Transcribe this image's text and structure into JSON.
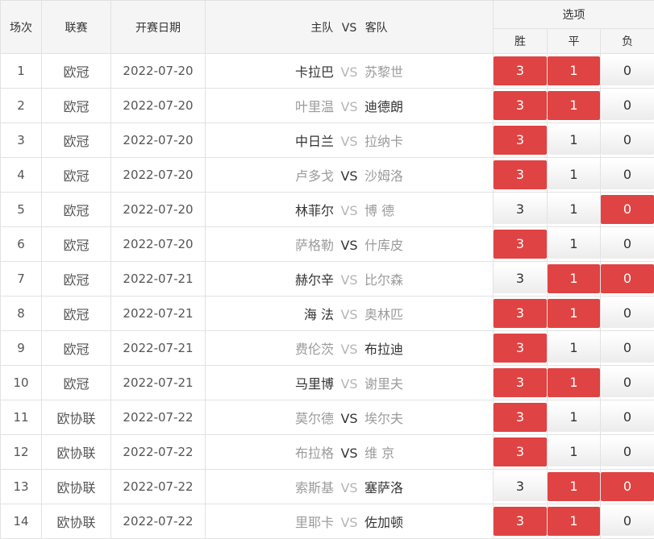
{
  "headers": {
    "index": "场次",
    "league": "联赛",
    "date": "开赛日期",
    "home": "主队",
    "vs": "VS",
    "away": "客队",
    "options": "选项",
    "win": "胜",
    "draw": "平",
    "loss": "负"
  },
  "colors": {
    "selected": "#e04343",
    "muted_text": "#9b9b9b",
    "header_bg": "#f5f5f5"
  },
  "rows": [
    {
      "index": "1",
      "league": "欧冠",
      "date": "2022-07-20",
      "home": "卡拉巴",
      "away": "苏黎世",
      "emph": "home",
      "win": "3",
      "draw": "1",
      "loss": "0",
      "sel": [
        true,
        true,
        false
      ]
    },
    {
      "index": "2",
      "league": "欧冠",
      "date": "2022-07-20",
      "home": "叶里温",
      "away": "迪德朗",
      "emph": "away",
      "win": "3",
      "draw": "1",
      "loss": "0",
      "sel": [
        true,
        true,
        false
      ]
    },
    {
      "index": "3",
      "league": "欧冠",
      "date": "2022-07-20",
      "home": "中日兰",
      "away": "拉纳卡",
      "emph": "home",
      "win": "3",
      "draw": "1",
      "loss": "0",
      "sel": [
        true,
        false,
        false
      ]
    },
    {
      "index": "4",
      "league": "欧冠",
      "date": "2022-07-20",
      "home": "卢多戈",
      "away": "沙姆洛",
      "emph": "none",
      "win": "3",
      "draw": "1",
      "loss": "0",
      "sel": [
        true,
        false,
        false
      ]
    },
    {
      "index": "5",
      "league": "欧冠",
      "date": "2022-07-20",
      "home": "林菲尔",
      "away": "博 德",
      "emph": "home",
      "win": "3",
      "draw": "1",
      "loss": "0",
      "sel": [
        false,
        false,
        true
      ]
    },
    {
      "index": "6",
      "league": "欧冠",
      "date": "2022-07-20",
      "home": "萨格勒",
      "away": "什库皮",
      "emph": "none",
      "win": "3",
      "draw": "1",
      "loss": "0",
      "sel": [
        true,
        false,
        false
      ]
    },
    {
      "index": "7",
      "league": "欧冠",
      "date": "2022-07-21",
      "home": "赫尔辛",
      "away": "比尔森",
      "emph": "home",
      "win": "3",
      "draw": "1",
      "loss": "0",
      "sel": [
        false,
        true,
        true
      ]
    },
    {
      "index": "8",
      "league": "欧冠",
      "date": "2022-07-21",
      "home": "海 法",
      "away": "奥林匹",
      "emph": "home",
      "win": "3",
      "draw": "1",
      "loss": "0",
      "sel": [
        true,
        true,
        false
      ]
    },
    {
      "index": "9",
      "league": "欧冠",
      "date": "2022-07-21",
      "home": "费伦茨",
      "away": "布拉迪",
      "emph": "away",
      "win": "3",
      "draw": "1",
      "loss": "0",
      "sel": [
        true,
        false,
        false
      ]
    },
    {
      "index": "10",
      "league": "欧冠",
      "date": "2022-07-21",
      "home": "马里博",
      "away": "谢里夫",
      "emph": "home",
      "win": "3",
      "draw": "1",
      "loss": "0",
      "sel": [
        true,
        true,
        false
      ]
    },
    {
      "index": "11",
      "league": "欧协联",
      "date": "2022-07-22",
      "home": "莫尔德",
      "away": "埃尔夫",
      "emph": "none",
      "win": "3",
      "draw": "1",
      "loss": "0",
      "sel": [
        true,
        false,
        false
      ]
    },
    {
      "index": "12",
      "league": "欧协联",
      "date": "2022-07-22",
      "home": "布拉格",
      "away": "维 京",
      "emph": "none",
      "win": "3",
      "draw": "1",
      "loss": "0",
      "sel": [
        true,
        false,
        false
      ]
    },
    {
      "index": "13",
      "league": "欧协联",
      "date": "2022-07-22",
      "home": "索斯基",
      "away": "塞萨洛",
      "emph": "away",
      "win": "3",
      "draw": "1",
      "loss": "0",
      "sel": [
        false,
        true,
        true
      ]
    },
    {
      "index": "14",
      "league": "欧协联",
      "date": "2022-07-22",
      "home": "里耶卡",
      "away": "佐加顿",
      "emph": "away",
      "win": "3",
      "draw": "1",
      "loss": "0",
      "sel": [
        true,
        true,
        false
      ]
    }
  ]
}
